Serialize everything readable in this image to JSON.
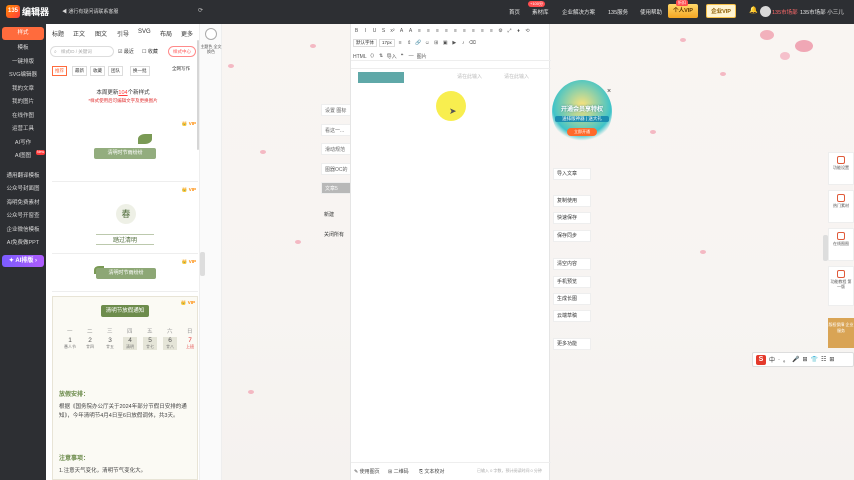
{
  "topbar": {
    "logo_mark": "135",
    "logo_text": "编辑器",
    "notice": "◀ 通行有疑问请联系客服",
    "nav": [
      "首页",
      "素材库",
      "企业解决方案",
      "135服务",
      "使用帮助"
    ],
    "nav_badge": "+100分",
    "vip_personal": "个人VIP",
    "vip_enterprise": "企业VIP",
    "vip_tag": "折扣",
    "team": "135市场部",
    "user": "135市场部 小三儿"
  },
  "sidebar": {
    "active": "样式",
    "items": [
      "模板",
      "一键排版",
      "SVG编辑器",
      "我的文章",
      "我的图片",
      "在线作图",
      "运营工具",
      "AI写作",
      "AI图图"
    ],
    "items2": [
      "通用翻译模板",
      "公众号封面图",
      "海明免费素材",
      "公众号开窗查",
      "企业微信模板",
      "AI免费做PPT"
    ],
    "new_badge": "New",
    "ai_button": "✦ AI排版 ›"
  },
  "panel": {
    "tabs": [
      "标题",
      "正文",
      "图文",
      "引导",
      "SVG",
      "布局",
      "更多"
    ],
    "template_center": "全屏模板中心",
    "search_placeholder": "样式ID / 关键词",
    "filters": [
      "最近",
      "收藏"
    ],
    "style_center": "样式中心",
    "sub_tabs": [
      "推荐",
      "最新",
      "收藏",
      "团队",
      "换一批"
    ],
    "sub_right": "全网写作",
    "update_prefix": "本周更新",
    "update_count": "104",
    "update_suffix": "个新样式",
    "update_sub": "*样式使用后可编辑文字及更换图片",
    "vip": "👑 VIP",
    "card1_banner": "清明时节雨纷纷",
    "card2_char": "春",
    "card2_banner": "踏过清明",
    "card3_banner": "清明时节雨纷纷",
    "calendar": {
      "title": "清明节放假通知",
      "weekdays": [
        "一",
        "二",
        "三",
        "四",
        "五",
        "六",
        "日"
      ],
      "days": [
        {
          "n": "1",
          "s": "愚人节"
        },
        {
          "n": "2",
          "s": "廿四"
        },
        {
          "n": "3",
          "s": "廿五"
        },
        {
          "n": "4",
          "s": "清明"
        },
        {
          "n": "5",
          "s": "廿七"
        },
        {
          "n": "6",
          "s": "廿八"
        },
        {
          "n": "7",
          "s": "上班"
        }
      ],
      "section1": "放假安排：",
      "text1": "根据《国务院办公厅关于2024年部分节假日安排的通知》，今年清明节4月4日至6日放假调休，共3天。",
      "section2": "注意事项：",
      "text2": "1.注意天气变化，清明节气变化大。"
    }
  },
  "templates_rail": {
    "label": "主题色 全文换色"
  },
  "edstrip": {
    "buttons": [
      "设置 图标",
      "看这一...",
      "滑动规范",
      "图器OC的"
    ],
    "dark_btn": "文章5",
    "plain": [
      "新建",
      "关闭所有"
    ]
  },
  "editor": {
    "row1": [
      "B",
      "I",
      "U",
      "S",
      "x²",
      "A",
      "A",
      "≡",
      "≡",
      "≡",
      "≡",
      "≡",
      "≡",
      "≡",
      "≡",
      "≡",
      "⚙",
      "⤢",
      "♦",
      "⟲"
    ],
    "font_select": "默认字体",
    "size_select": "17px",
    "row3_left": "HTML",
    "row3_mid": "导入",
    "row3_right": "图片",
    "placeholder1": "请在此输入",
    "placeholder2": "请在此输入",
    "bottom": [
      "✎ 使用图页",
      "⊞ 二维码",
      "⎘ 文本校对"
    ],
    "bottom_right": "已输入 0 字数，预计阅读时间 0 分钟"
  },
  "promo": {
    "title": "开通会员享特权",
    "sub": "送排版神器 | 送大礼",
    "btn": "立即开通",
    "close": "×"
  },
  "actions": [
    "导入文章",
    "复制使用",
    "快速保存",
    "保存同步",
    "清空内容",
    "手机预览",
    "生成长图",
    "云端草稿",
    "更多功能"
  ],
  "rail": {
    "items": [
      "功能设置",
      "热门素材",
      "在线图图",
      "功能教程 第一版"
    ],
    "promo": "版权保障 企业服务"
  },
  "ime": {
    "letter": "S",
    "chars": [
      "中",
      "·",
      "。",
      "🎤",
      "⊞",
      "👕",
      "☷",
      "⊞"
    ]
  },
  "colors": {
    "accent": "#ff6b3d",
    "dark": "#2d2f33",
    "green": "#6d8c4c"
  }
}
